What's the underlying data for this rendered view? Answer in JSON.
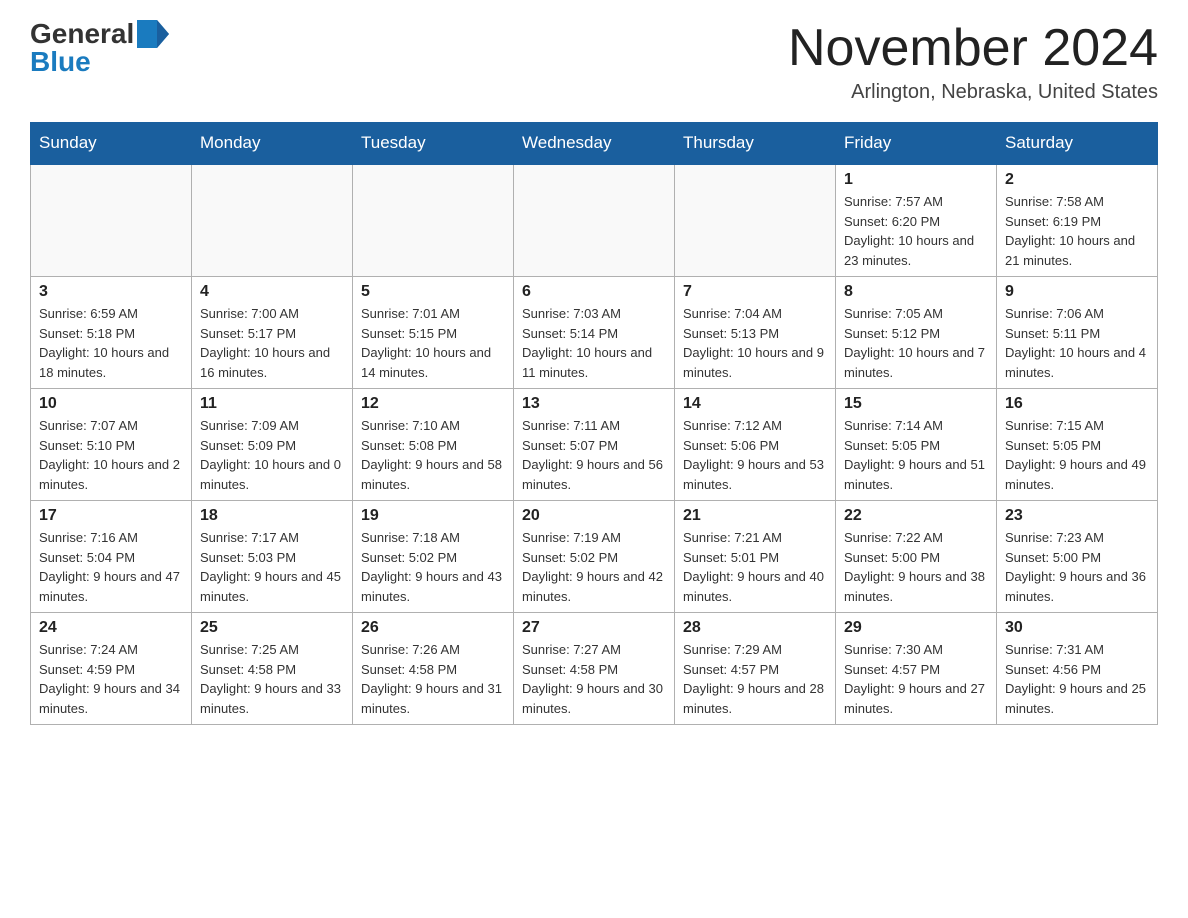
{
  "header": {
    "logo_general": "General",
    "logo_blue": "Blue",
    "title": "November 2024",
    "subtitle": "Arlington, Nebraska, United States"
  },
  "days_of_week": [
    "Sunday",
    "Monday",
    "Tuesday",
    "Wednesday",
    "Thursday",
    "Friday",
    "Saturday"
  ],
  "weeks": [
    [
      {
        "day": "",
        "info": ""
      },
      {
        "day": "",
        "info": ""
      },
      {
        "day": "",
        "info": ""
      },
      {
        "day": "",
        "info": ""
      },
      {
        "day": "",
        "info": ""
      },
      {
        "day": "1",
        "info": "Sunrise: 7:57 AM\nSunset: 6:20 PM\nDaylight: 10 hours and 23 minutes."
      },
      {
        "day": "2",
        "info": "Sunrise: 7:58 AM\nSunset: 6:19 PM\nDaylight: 10 hours and 21 minutes."
      }
    ],
    [
      {
        "day": "3",
        "info": "Sunrise: 6:59 AM\nSunset: 5:18 PM\nDaylight: 10 hours and 18 minutes."
      },
      {
        "day": "4",
        "info": "Sunrise: 7:00 AM\nSunset: 5:17 PM\nDaylight: 10 hours and 16 minutes."
      },
      {
        "day": "5",
        "info": "Sunrise: 7:01 AM\nSunset: 5:15 PM\nDaylight: 10 hours and 14 minutes."
      },
      {
        "day": "6",
        "info": "Sunrise: 7:03 AM\nSunset: 5:14 PM\nDaylight: 10 hours and 11 minutes."
      },
      {
        "day": "7",
        "info": "Sunrise: 7:04 AM\nSunset: 5:13 PM\nDaylight: 10 hours and 9 minutes."
      },
      {
        "day": "8",
        "info": "Sunrise: 7:05 AM\nSunset: 5:12 PM\nDaylight: 10 hours and 7 minutes."
      },
      {
        "day": "9",
        "info": "Sunrise: 7:06 AM\nSunset: 5:11 PM\nDaylight: 10 hours and 4 minutes."
      }
    ],
    [
      {
        "day": "10",
        "info": "Sunrise: 7:07 AM\nSunset: 5:10 PM\nDaylight: 10 hours and 2 minutes."
      },
      {
        "day": "11",
        "info": "Sunrise: 7:09 AM\nSunset: 5:09 PM\nDaylight: 10 hours and 0 minutes."
      },
      {
        "day": "12",
        "info": "Sunrise: 7:10 AM\nSunset: 5:08 PM\nDaylight: 9 hours and 58 minutes."
      },
      {
        "day": "13",
        "info": "Sunrise: 7:11 AM\nSunset: 5:07 PM\nDaylight: 9 hours and 56 minutes."
      },
      {
        "day": "14",
        "info": "Sunrise: 7:12 AM\nSunset: 5:06 PM\nDaylight: 9 hours and 53 minutes."
      },
      {
        "day": "15",
        "info": "Sunrise: 7:14 AM\nSunset: 5:05 PM\nDaylight: 9 hours and 51 minutes."
      },
      {
        "day": "16",
        "info": "Sunrise: 7:15 AM\nSunset: 5:05 PM\nDaylight: 9 hours and 49 minutes."
      }
    ],
    [
      {
        "day": "17",
        "info": "Sunrise: 7:16 AM\nSunset: 5:04 PM\nDaylight: 9 hours and 47 minutes."
      },
      {
        "day": "18",
        "info": "Sunrise: 7:17 AM\nSunset: 5:03 PM\nDaylight: 9 hours and 45 minutes."
      },
      {
        "day": "19",
        "info": "Sunrise: 7:18 AM\nSunset: 5:02 PM\nDaylight: 9 hours and 43 minutes."
      },
      {
        "day": "20",
        "info": "Sunrise: 7:19 AM\nSunset: 5:02 PM\nDaylight: 9 hours and 42 minutes."
      },
      {
        "day": "21",
        "info": "Sunrise: 7:21 AM\nSunset: 5:01 PM\nDaylight: 9 hours and 40 minutes."
      },
      {
        "day": "22",
        "info": "Sunrise: 7:22 AM\nSunset: 5:00 PM\nDaylight: 9 hours and 38 minutes."
      },
      {
        "day": "23",
        "info": "Sunrise: 7:23 AM\nSunset: 5:00 PM\nDaylight: 9 hours and 36 minutes."
      }
    ],
    [
      {
        "day": "24",
        "info": "Sunrise: 7:24 AM\nSunset: 4:59 PM\nDaylight: 9 hours and 34 minutes."
      },
      {
        "day": "25",
        "info": "Sunrise: 7:25 AM\nSunset: 4:58 PM\nDaylight: 9 hours and 33 minutes."
      },
      {
        "day": "26",
        "info": "Sunrise: 7:26 AM\nSunset: 4:58 PM\nDaylight: 9 hours and 31 minutes."
      },
      {
        "day": "27",
        "info": "Sunrise: 7:27 AM\nSunset: 4:58 PM\nDaylight: 9 hours and 30 minutes."
      },
      {
        "day": "28",
        "info": "Sunrise: 7:29 AM\nSunset: 4:57 PM\nDaylight: 9 hours and 28 minutes."
      },
      {
        "day": "29",
        "info": "Sunrise: 7:30 AM\nSunset: 4:57 PM\nDaylight: 9 hours and 27 minutes."
      },
      {
        "day": "30",
        "info": "Sunrise: 7:31 AM\nSunset: 4:56 PM\nDaylight: 9 hours and 25 minutes."
      }
    ]
  ]
}
